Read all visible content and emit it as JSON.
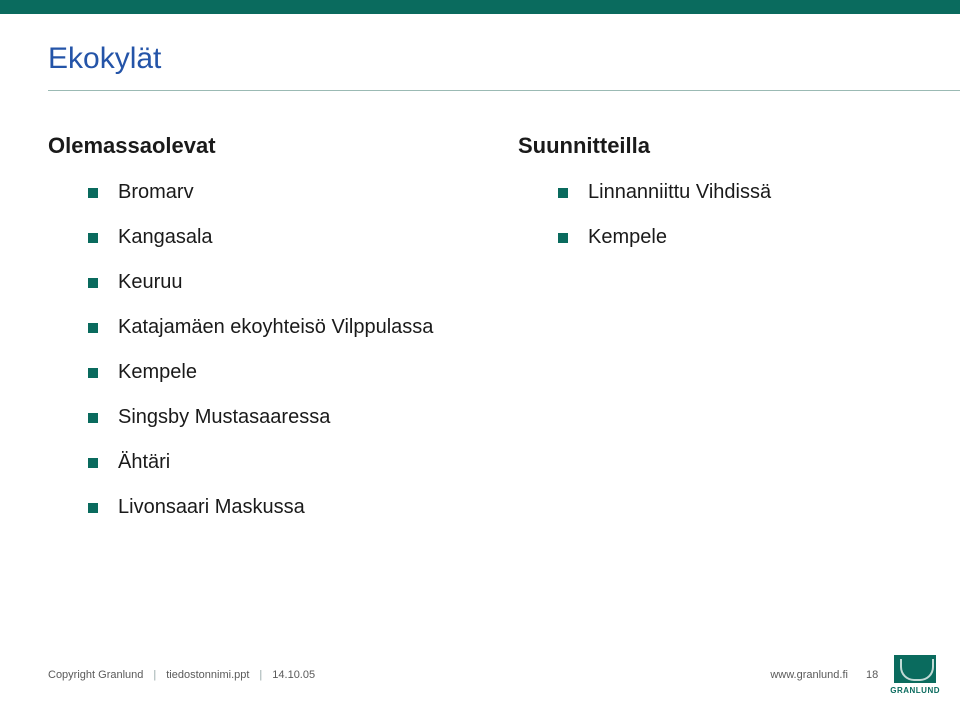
{
  "title": "Ekokylät",
  "left": {
    "heading": "Olemassaolevat",
    "items": [
      "Bromarv",
      "Kangasala",
      "Keuruu",
      "Katajamäen ekoyhteisö Vilppulassa",
      "Kempele",
      "Singsby Mustasaaressa",
      "Ähtäri",
      "Livonsaari Maskussa"
    ]
  },
  "right": {
    "heading": "Suunnitteilla",
    "items": [
      "Linnanniittu Vihdissä",
      "Kempele"
    ]
  },
  "footer": {
    "copyright": "Copyright Granlund",
    "filename": "tiedostonnimi.ppt",
    "date": "14.10.05",
    "url": "www.granlund.fi",
    "page": "18",
    "brand": "GRANLUND"
  }
}
